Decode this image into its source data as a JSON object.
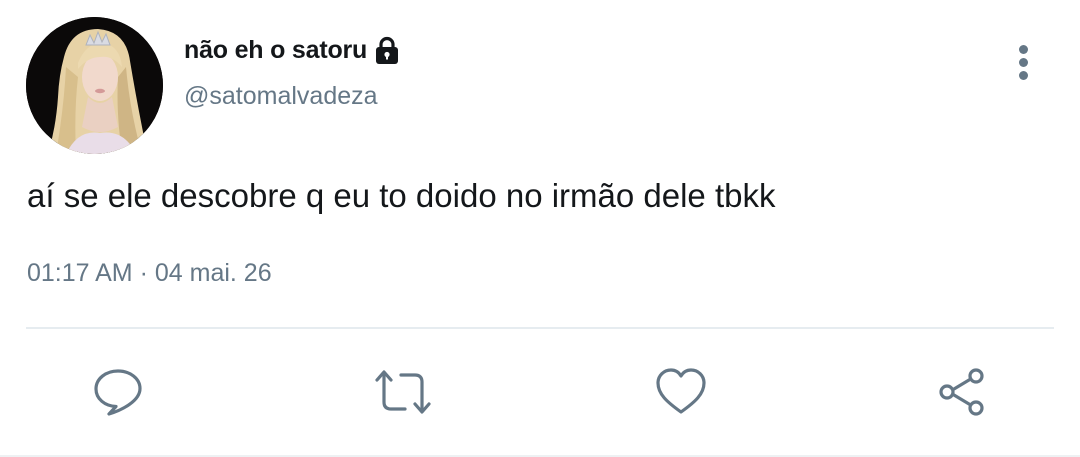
{
  "tweet": {
    "display_name": "não eh o satoru",
    "handle": "@satomalvadeza",
    "text": "aí se ele descobre q eu to doido no irmão dele tbkk",
    "time": "01:17 AM",
    "separator": "·",
    "date": "04 mai. 26",
    "protected_icon": "lock-icon",
    "more_icon": "more-vertical-icon"
  },
  "actions": {
    "reply_icon": "reply-icon",
    "retweet_icon": "retweet-icon",
    "like_icon": "heart-icon",
    "share_icon": "share-icon"
  },
  "colors": {
    "text_primary": "#14171a",
    "text_secondary": "#657786",
    "divider": "#e6ecf0"
  }
}
